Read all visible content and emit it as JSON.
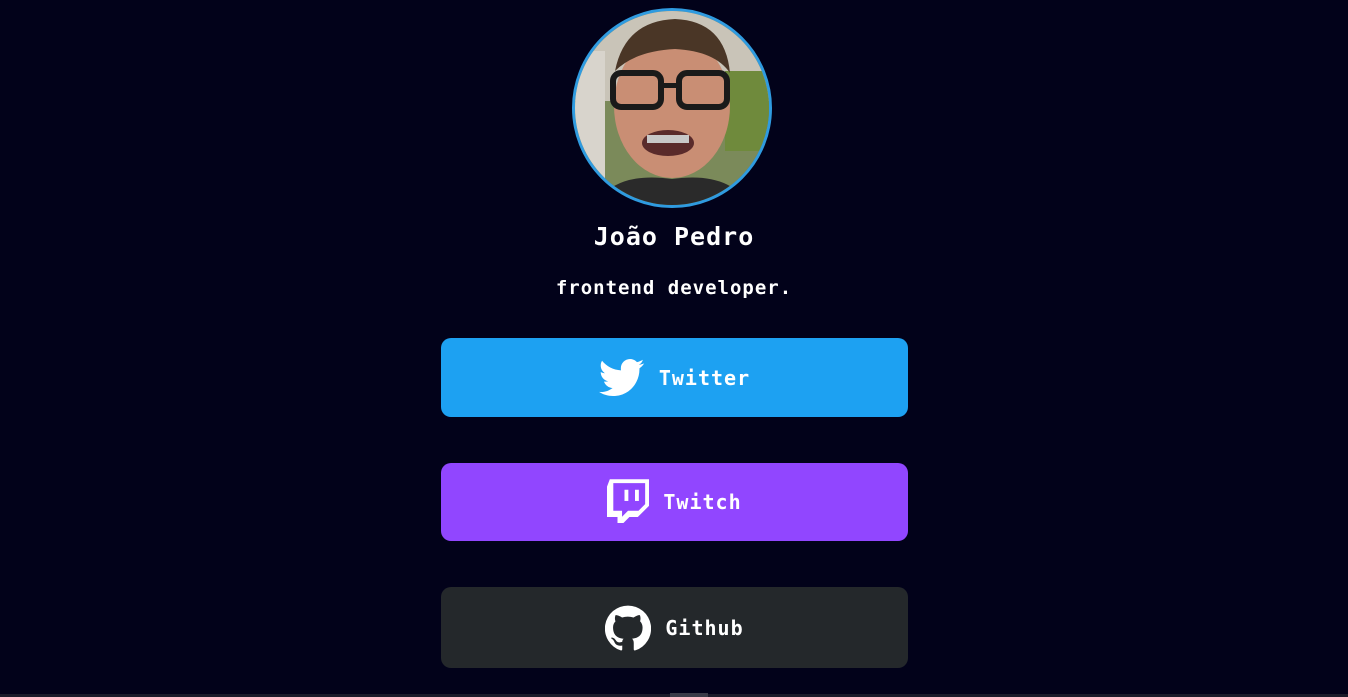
{
  "profile": {
    "name": "João Pedro",
    "role": "frontend developer."
  },
  "links": [
    {
      "label": "Twitter",
      "icon": "twitter-bird-icon",
      "color": "#1da1f2"
    },
    {
      "label": "Twitch",
      "icon": "twitch-icon",
      "color": "#9146ff"
    },
    {
      "label": "Github",
      "icon": "github-octocat-icon",
      "color": "#24282b"
    }
  ],
  "colors": {
    "background": "#02021a",
    "avatar_border": "#2f9be0"
  }
}
